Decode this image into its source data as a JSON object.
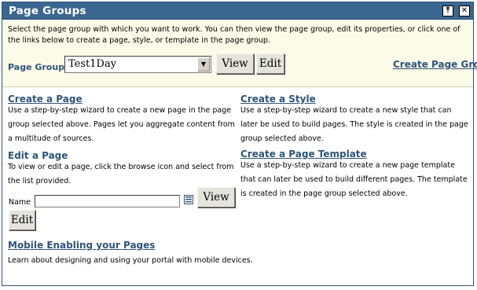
{
  "portlet": {
    "title": "Page Groups",
    "titlebar_buttons": {
      "up": "⤒",
      "close": "✕"
    }
  },
  "top": {
    "intro": "Select the page group with which you want to work. You can then view the page group, edit its properties, or click one of the links below to create a page, style, or template in the page group.",
    "page_group_label": "Page Group",
    "page_group_value": "Test1Day",
    "view_button": "View",
    "edit_button": "Edit",
    "create_page_group_link": "Create Page Group"
  },
  "sections": {
    "create_page": {
      "title": "Create a Page",
      "desc": "Use a step-by-step wizard to create a new page in the page group selected above. Pages let you aggregate content from a multitude of sources."
    },
    "create_style": {
      "title": "Create a Style",
      "desc": "Use a step-by-step wizard to create a new style that can later be used to build pages. The style is created in the page group selected above."
    },
    "edit_page": {
      "title": "Edit a Page",
      "desc": "To view or edit a page, click the browse icon and select from the list provided.",
      "name_label": "Name",
      "name_value": "",
      "view_button": "View",
      "edit_button": "Edit"
    },
    "create_template": {
      "title": "Create a Page Template",
      "desc": "Use a step-by-step wizard to create a new page template that can later be used to build different pages. The template is created in the page group selected above."
    },
    "mobile": {
      "title": "Mobile Enabling your Pages",
      "desc": "Learn about designing and using your portal with mobile devices."
    }
  },
  "colors": {
    "titlebar": "#3b6690",
    "link": "#2f5479",
    "top_band": "#fbfbe8"
  }
}
